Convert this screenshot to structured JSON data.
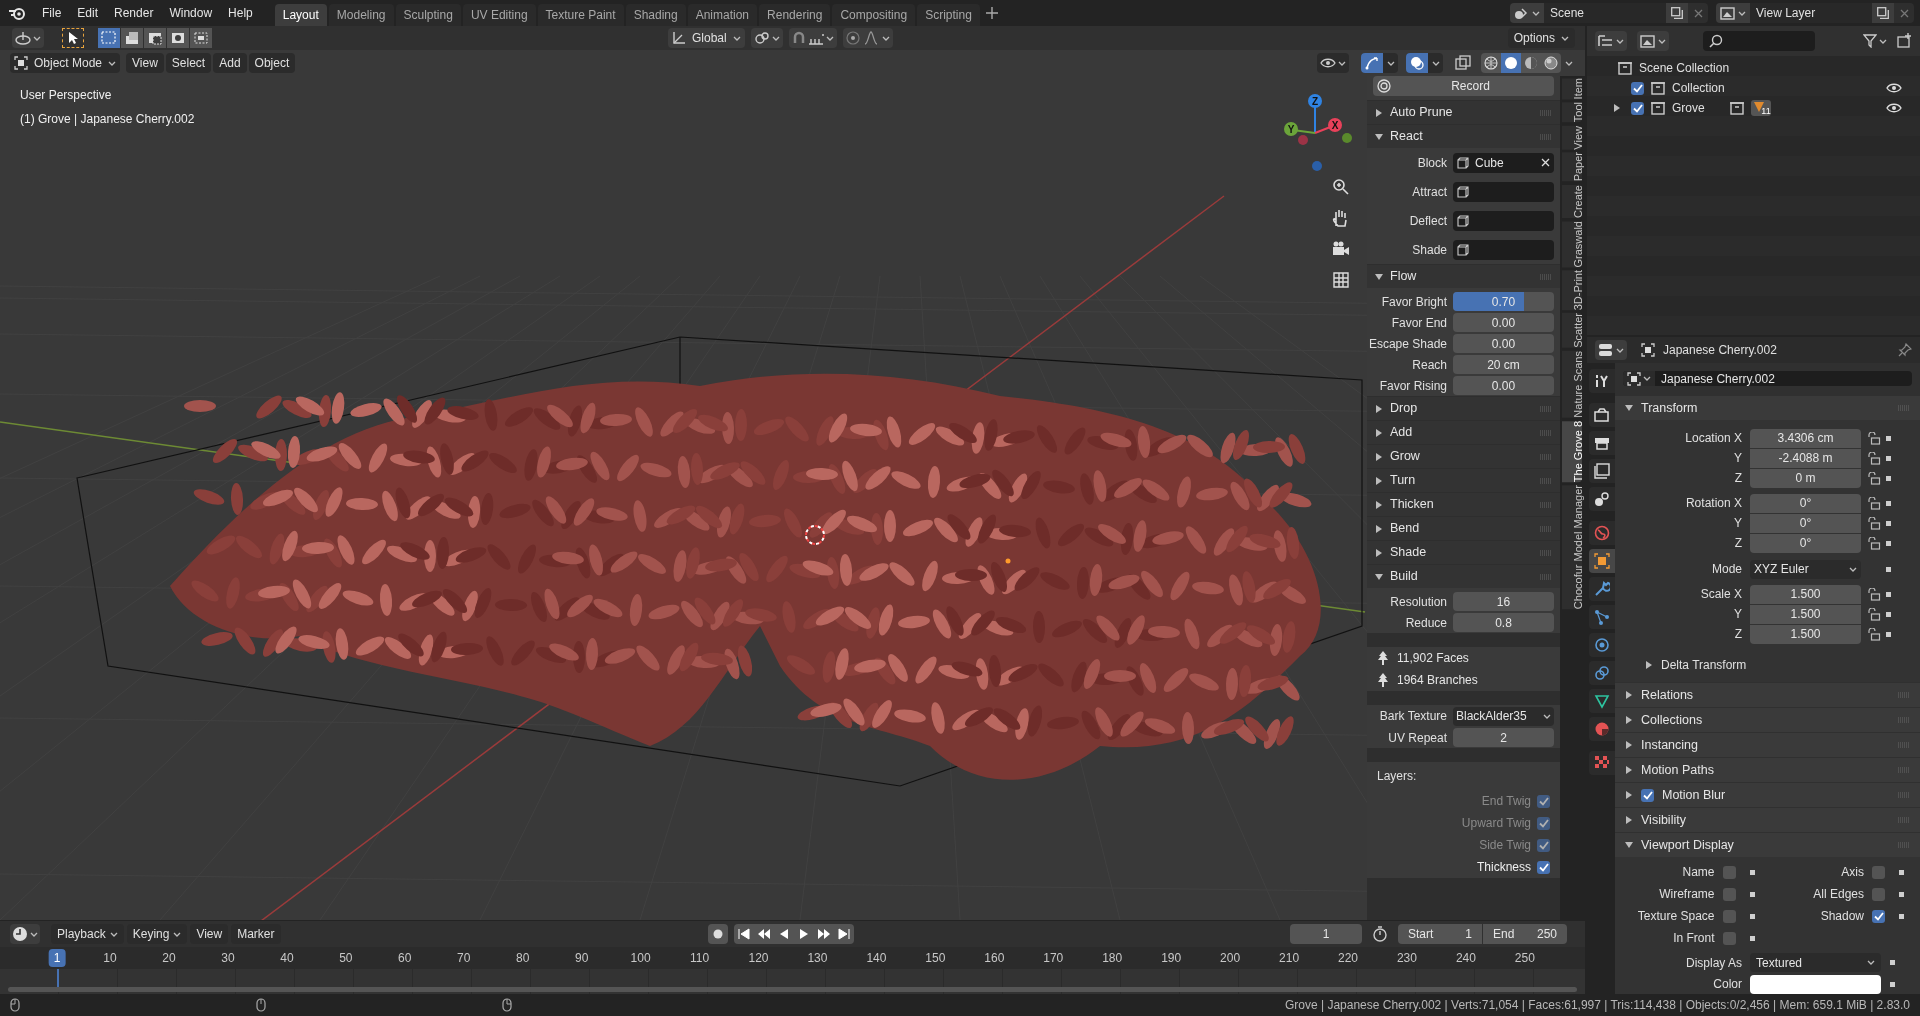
{
  "menu": [
    "File",
    "Edit",
    "Render",
    "Window",
    "Help"
  ],
  "workspaces": [
    {
      "label": "Layout",
      "selected": true
    },
    {
      "label": "Modeling",
      "selected": false
    },
    {
      "label": "Sculpting",
      "selected": false
    },
    {
      "label": "UV Editing",
      "selected": false
    },
    {
      "label": "Texture Paint",
      "selected": false
    },
    {
      "label": "Shading",
      "selected": false
    },
    {
      "label": "Animation",
      "selected": false
    },
    {
      "label": "Rendering",
      "selected": false
    },
    {
      "label": "Compositing",
      "selected": false
    },
    {
      "label": "Scripting",
      "selected": false
    }
  ],
  "scene": "Scene",
  "view_layer": "View Layer",
  "viewport": {
    "orientation": "Global",
    "options": "Options",
    "mode": "Object Mode",
    "menus": [
      "View",
      "Select",
      "Add",
      "Object"
    ],
    "info": [
      "User Perspective",
      "(1) Grove | Japanese Cherry.002"
    ],
    "gizmo_axes": [
      "Z",
      "X",
      "Y"
    ],
    "gizmos_on": true,
    "overlays_on": true,
    "shading": [
      {
        "kind": "wireframe",
        "selected": false
      },
      {
        "kind": "solid",
        "selected": true
      },
      {
        "kind": "material",
        "selected": false
      },
      {
        "kind": "rendered",
        "selected": false
      }
    ]
  },
  "sidebar": {
    "tabs": [
      {
        "label": "Item",
        "selected": false
      },
      {
        "label": "Tool",
        "selected": false
      },
      {
        "label": "View",
        "selected": false
      },
      {
        "label": "Paper",
        "selected": false
      },
      {
        "label": "Create",
        "selected": false
      },
      {
        "label": "Graswald",
        "selected": false
      },
      {
        "label": "3D-Print",
        "selected": false
      },
      {
        "label": "Scatter",
        "selected": false
      },
      {
        "label": "Nature Scans",
        "selected": false
      },
      {
        "label": "The Grove 8",
        "selected": true
      },
      {
        "label": "Chocofur Model Manager",
        "selected": false
      }
    ],
    "items": [
      {
        "kind": "button",
        "label": "Record"
      },
      {
        "kind": "section",
        "label": "Auto Prune",
        "expanded": false
      },
      {
        "kind": "section",
        "label": "React",
        "expanded": true
      },
      {
        "kind": "object",
        "label": "Block",
        "value": "Cube"
      },
      {
        "kind": "object",
        "label": "Attract"
      },
      {
        "kind": "object",
        "label": "Deflect"
      },
      {
        "kind": "object",
        "label": "Shade"
      },
      {
        "kind": "section",
        "label": "Flow",
        "expanded": true
      },
      {
        "kind": "number",
        "label": "Favor Bright",
        "value": "0.70",
        "level": 0.7
      },
      {
        "kind": "number",
        "label": "Favor End",
        "value": "0.00"
      },
      {
        "kind": "number",
        "label": "Escape Shade",
        "value": "0.00"
      },
      {
        "kind": "number",
        "label": "Reach",
        "value": "20 cm"
      },
      {
        "kind": "number",
        "label": "Favor Rising",
        "value": "0.00"
      },
      {
        "kind": "section",
        "label": "Drop",
        "expanded": false
      },
      {
        "kind": "section",
        "label": "Add",
        "expanded": false
      },
      {
        "kind": "section",
        "label": "Grow",
        "expanded": false
      },
      {
        "kind": "section",
        "label": "Turn",
        "expanded": false
      },
      {
        "kind": "section",
        "label": "Thicken",
        "expanded": false
      },
      {
        "kind": "section",
        "label": "Bend",
        "expanded": false
      },
      {
        "kind": "section",
        "label": "Shade",
        "expanded": false
      },
      {
        "kind": "section",
        "label": "Build",
        "expanded": true
      },
      {
        "kind": "number",
        "label": "Resolution",
        "value": "16"
      },
      {
        "kind": "number",
        "label": "Reduce",
        "value": "0.8"
      },
      {
        "kind": "stat",
        "label": "11,902 Faces"
      },
      {
        "kind": "stat",
        "label": "1964 Branches"
      },
      {
        "kind": "dropdown",
        "label": "Bark Texture",
        "value": "BlackAlder35"
      },
      {
        "kind": "number",
        "label": "UV Repeat",
        "value": "2"
      },
      {
        "kind": "caption",
        "label": "Layers:"
      },
      {
        "kind": "checkbox",
        "label": "End Twig",
        "checked": true,
        "disabled": true
      },
      {
        "kind": "checkbox",
        "label": "Upward Twig",
        "checked": true,
        "disabled": true
      },
      {
        "kind": "checkbox",
        "label": "Side Twig",
        "checked": true,
        "disabled": true
      },
      {
        "kind": "checkbox",
        "label": "Thickness",
        "checked": true,
        "disabled": false
      }
    ]
  },
  "outliner": {
    "root": "Scene Collection",
    "children": [
      {
        "label": "Collection",
        "checked": true,
        "visible": true
      },
      {
        "label": "Grove",
        "checked": true,
        "visible": true,
        "expanded": false,
        "badge": "11"
      }
    ]
  },
  "properties": {
    "object": "Japanese Cherry.002",
    "name": "Japanese Cherry.002",
    "tabs": [
      {
        "kind": "tool",
        "selected": false
      },
      {
        "kind": "render",
        "selected": false
      },
      {
        "kind": "output",
        "selected": false
      },
      {
        "kind": "view-layer",
        "selected": false
      },
      {
        "kind": "scene",
        "selected": false
      },
      {
        "kind": "world",
        "selected": false
      },
      {
        "kind": "object",
        "selected": true
      },
      {
        "kind": "modifier",
        "selected": false
      },
      {
        "kind": "particles",
        "selected": false
      },
      {
        "kind": "physics",
        "selected": false
      },
      {
        "kind": "constraints",
        "selected": false
      },
      {
        "kind": "data",
        "selected": false
      },
      {
        "kind": "material",
        "selected": false
      },
      {
        "kind": "texture",
        "selected": false
      }
    ],
    "transform": {
      "label": "Transform",
      "expanded": true,
      "rows": [
        {
          "kind": "number",
          "label": "Location X",
          "value": "3.4306 cm"
        },
        {
          "kind": "number",
          "label": "Y",
          "value": "-2.4088 m"
        },
        {
          "kind": "number",
          "label": "Z",
          "value": "0 m"
        },
        {
          "kind": "number",
          "label": "Rotation X",
          "value": "0°"
        },
        {
          "kind": "number",
          "label": "Y",
          "value": "0°"
        },
        {
          "kind": "number",
          "label": "Z",
          "value": "0°"
        },
        {
          "kind": "dropdown",
          "label": "Mode",
          "value": "XYZ Euler"
        },
        {
          "kind": "number",
          "label": "Scale X",
          "value": "1.500"
        },
        {
          "kind": "number",
          "label": "Y",
          "value": "1.500"
        },
        {
          "kind": "number",
          "label": "Z",
          "value": "1.500"
        }
      ]
    },
    "subsection": {
      "label": "Delta Transform",
      "expanded": false
    },
    "sections": [
      {
        "label": "Relations",
        "expanded": false
      },
      {
        "label": "Collections",
        "expanded": false
      },
      {
        "label": "Instancing",
        "expanded": false
      },
      {
        "label": "Motion Paths",
        "expanded": false
      },
      {
        "label": "Motion Blur",
        "expanded": false,
        "checked": true
      },
      {
        "label": "Visibility",
        "expanded": false
      },
      {
        "label": "Viewport Display",
        "expanded": true
      }
    ],
    "viewport_display": {
      "checks": [
        {
          "label": "Name",
          "checked": false
        },
        {
          "label": "Axis",
          "checked": false
        },
        {
          "label": "Wireframe",
          "checked": false
        },
        {
          "label": "All Edges",
          "checked": false
        },
        {
          "label": "Texture Space",
          "checked": false
        },
        {
          "label": "Shadow",
          "checked": true
        },
        {
          "label": "In Front",
          "checked": false
        }
      ],
      "display_as": {
        "label": "Display As",
        "value": "Textured"
      },
      "color": {
        "label": "Color",
        "color": "#ffffff"
      }
    }
  },
  "timeline": {
    "menus": [
      "Playback",
      "Keying",
      "View",
      "Marker"
    ],
    "current_frame": "1",
    "start_label": "Start",
    "start": "1",
    "end_label": "End",
    "end": "250",
    "ruler": [
      {
        "label": "1",
        "selected": true
      },
      {
        "label": "10",
        "selected": false
      },
      {
        "label": "20",
        "selected": false
      },
      {
        "label": "30",
        "selected": false
      },
      {
        "label": "40",
        "selected": false
      },
      {
        "label": "50",
        "selected": false
      },
      {
        "label": "60",
        "selected": false
      },
      {
        "label": "70",
        "selected": false
      },
      {
        "label": "80",
        "selected": false
      },
      {
        "label": "90",
        "selected": false
      },
      {
        "label": "100",
        "selected": false
      },
      {
        "label": "110",
        "selected": false
      },
      {
        "label": "120",
        "selected": false
      },
      {
        "label": "130",
        "selected": false
      },
      {
        "label": "140",
        "selected": false
      },
      {
        "label": "150",
        "selected": false
      },
      {
        "label": "160",
        "selected": false
      },
      {
        "label": "170",
        "selected": false
      },
      {
        "label": "180",
        "selected": false
      },
      {
        "label": "190",
        "selected": false
      },
      {
        "label": "200",
        "selected": false
      },
      {
        "label": "210",
        "selected": false
      },
      {
        "label": "220",
        "selected": false
      },
      {
        "label": "230",
        "selected": false
      },
      {
        "label": "240",
        "selected": false
      },
      {
        "label": "250",
        "selected": false
      }
    ]
  },
  "status_bar": "Grove | Japanese Cherry.002 | Verts:71,054 | Faces:61,997 | Tris:114,438 | Objects:0/2,456 | Mem: 659.1 MiB | 2.83.0"
}
